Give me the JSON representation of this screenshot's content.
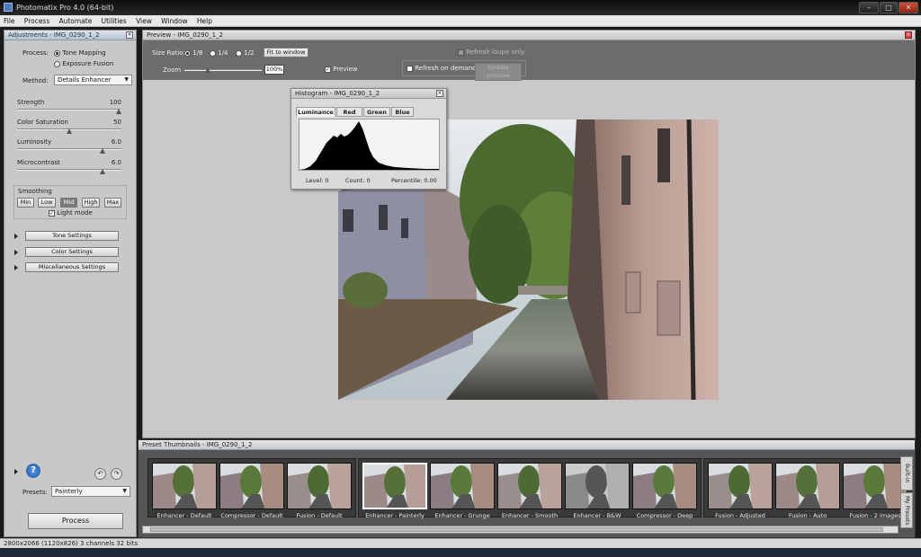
{
  "window": {
    "title": "Photomatix Pro 4.0 (64-bit)"
  },
  "menu": [
    "File",
    "Process",
    "Automate",
    "Utilities",
    "View",
    "Window",
    "Help"
  ],
  "adjustments": {
    "title": "Adjustments - IMG_0290_1_2",
    "process_label": "Process:",
    "process_options": [
      "Tone Mapping",
      "Exposure Fusion"
    ],
    "method_label": "Method:",
    "method_value": "Details Enhancer",
    "sliders": [
      {
        "label": "Strength",
        "value": "100",
        "fraction": 0.98
      },
      {
        "label": "Color Saturation",
        "value": "50",
        "fraction": 0.5
      },
      {
        "label": "Luminosity",
        "value": "6.0",
        "fraction": 0.75
      },
      {
        "label": "Microcontrast",
        "value": "6.0",
        "fraction": 0.75
      }
    ],
    "smoothing_label": "Smoothing",
    "smoothing_options": [
      "Min",
      "Low",
      "Mid",
      "High",
      "Max"
    ],
    "smoothing_selected": "Mid",
    "light_mode_label": "Light mode",
    "sections": [
      "Tone Settings",
      "Color Settings",
      "Miscellaneous Settings"
    ],
    "presets_label": "Presets:",
    "presets_value": "Painterly",
    "process_button": "Process"
  },
  "preview": {
    "title": "Preview - IMG_0290_1_2",
    "size_ratio_label": "Size Ratio:",
    "ratios": [
      "1/8",
      "1/4",
      "1/2"
    ],
    "fit_button": "Fit to window",
    "zoom_label": "Zoom",
    "zoom_value": "100%",
    "preview_label": "Preview",
    "refresh_loupe_label": "Refresh loupe only",
    "refresh_demand_label": "Refresh on demand:",
    "update_button": "Update preview"
  },
  "histogram": {
    "title": "Histogram - IMG_0290_1_2",
    "tabs": [
      "Luminance",
      "Red",
      "Green",
      "Blue"
    ],
    "level": "Level: 0",
    "count": "Count: 0",
    "percentile": "Percentile: 0.00"
  },
  "presets_panel": {
    "title": "Preset Thumbnails - IMG_0290_1_2",
    "groups": [
      [
        "Enhancer - Default",
        "Compressor - Default",
        "Fusion - Default"
      ],
      [
        "Enhancer - Painterly",
        "Enhancer - Grunge",
        "Enhancer - Smooth",
        "Enhancer - B&W",
        "Compressor - Deep"
      ],
      [
        "Fusion - Adjusted",
        "Fusion - Auto",
        "Fusion - 2 images"
      ]
    ],
    "side_tabs": [
      "Built-in",
      "My Presets"
    ]
  },
  "status": "2800x2066 (1120x826) 3 channels 32 bits",
  "colors": {
    "panel": "#c8c8c8",
    "toolbar": "#6c6c6c",
    "accent_blue": "#2e6fc8"
  }
}
